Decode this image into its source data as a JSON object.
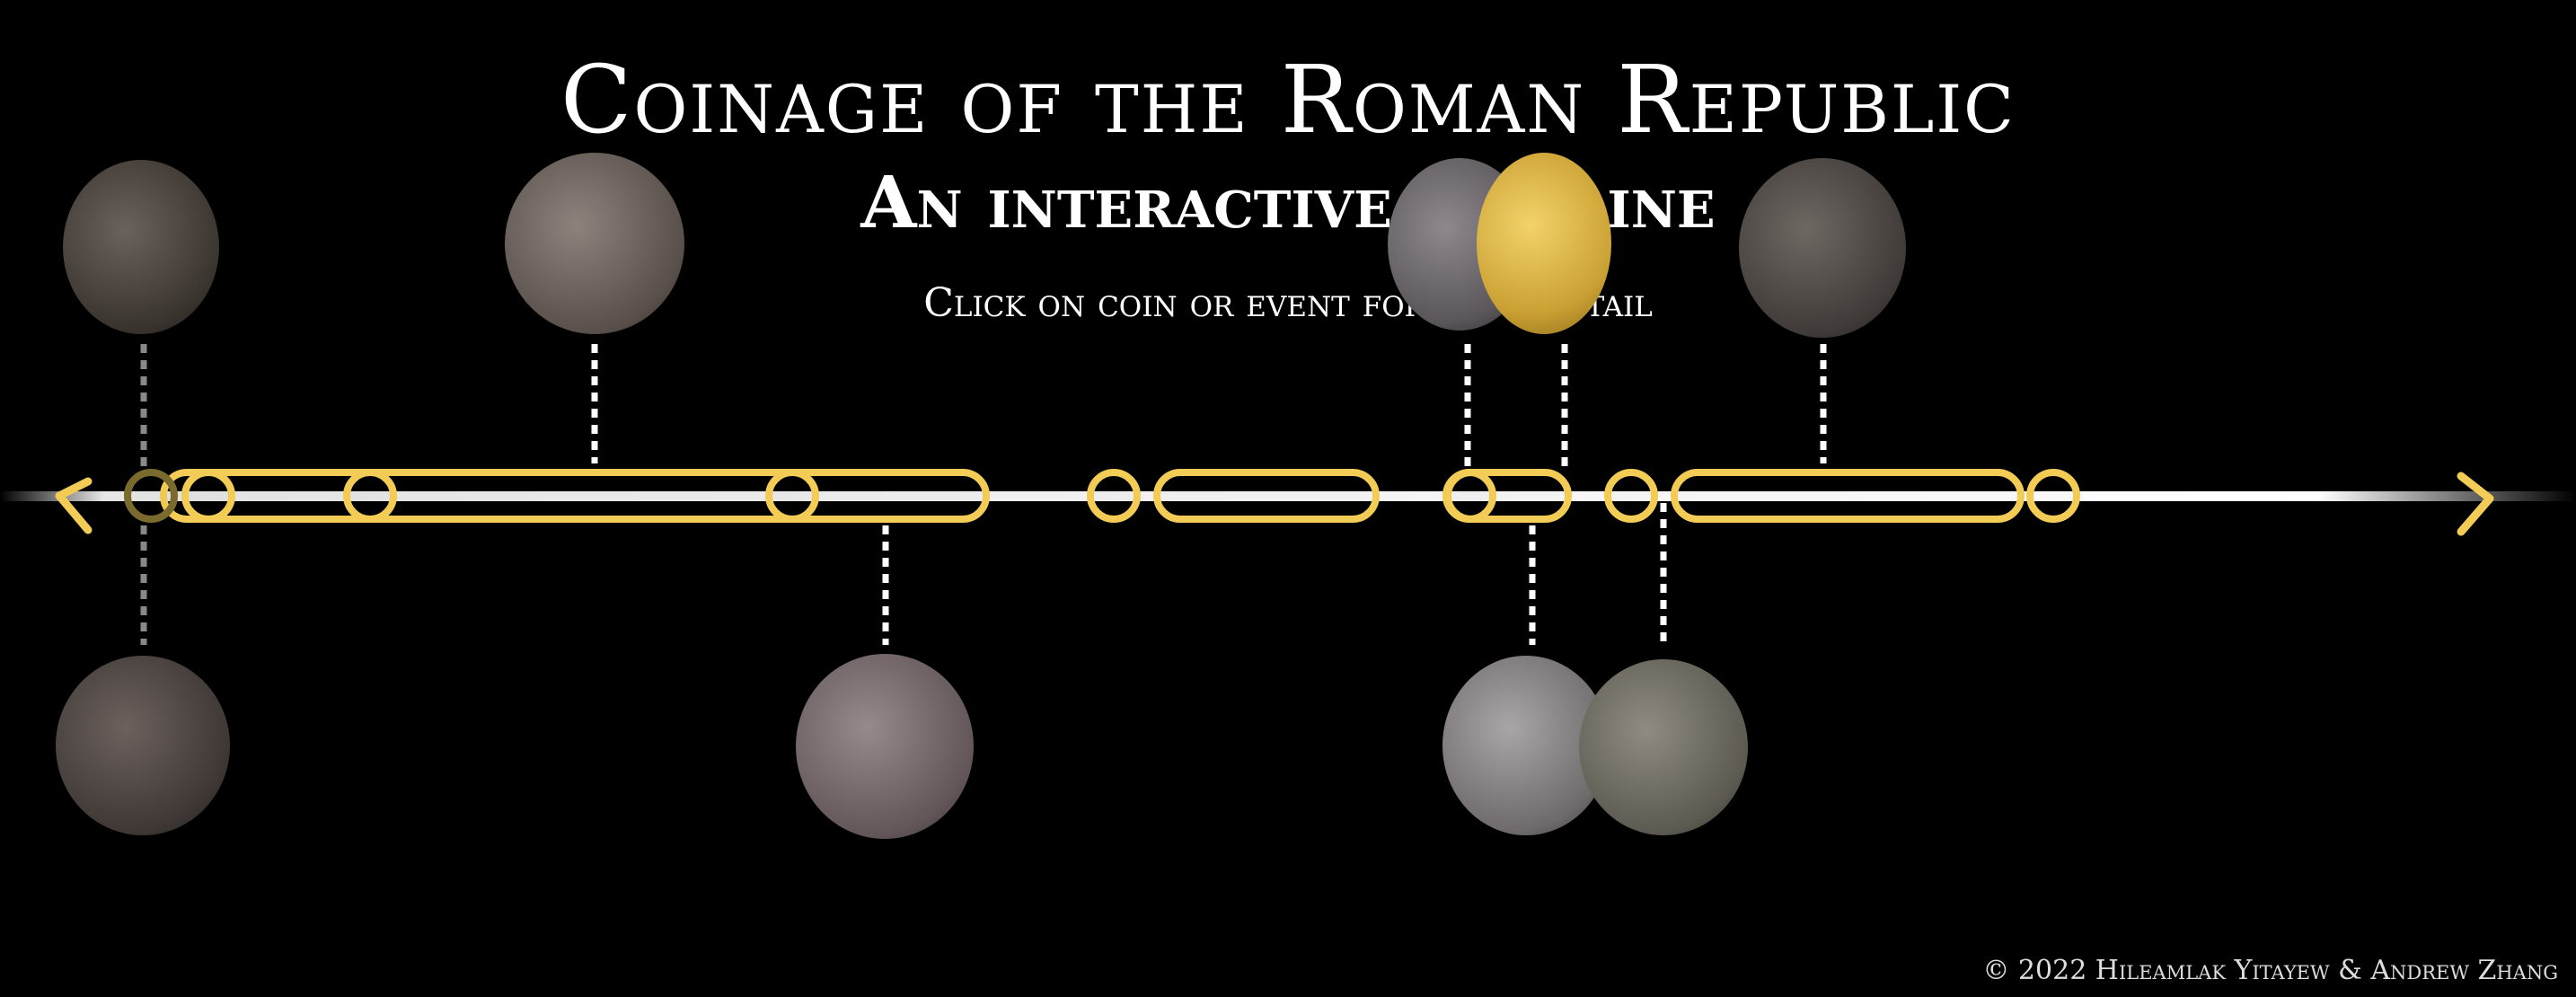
{
  "header": {
    "title": "Coinage of the Roman Republic",
    "subtitle": "An interactive timeline",
    "hint": "Click on coin or event for more detail"
  },
  "footer": {
    "credit": "© 2022 Hileamlak Yitayew & Andrew Zhang"
  },
  "timeline": {
    "accent_color": "#f2cc55",
    "line_color": "#ffffff"
  },
  "coins_top": [
    {
      "name": "coin-laureate-head-icon",
      "tone": "#4a423c"
    },
    {
      "name": "coin-jupiter-head-icon",
      "tone": "#6d625d"
    },
    {
      "name": "coin-elephant-icon",
      "tone": "#6c666a"
    },
    {
      "name": "coin-gold-aureus-icon",
      "tone": "#d2a93a"
    },
    {
      "name": "coin-caesar-portrait-icon",
      "tone": "#4b4643"
    }
  ],
  "coins_bottom": [
    {
      "name": "coin-female-head-icon",
      "tone": "#4b4340"
    },
    {
      "name": "coin-turreted-head-icon",
      "tone": "#746669"
    },
    {
      "name": "coin-apollo-head-icon",
      "tone": "#8a8587"
    },
    {
      "name": "coin-brutus-portrait-icon",
      "tone": "#6f6b61"
    }
  ]
}
